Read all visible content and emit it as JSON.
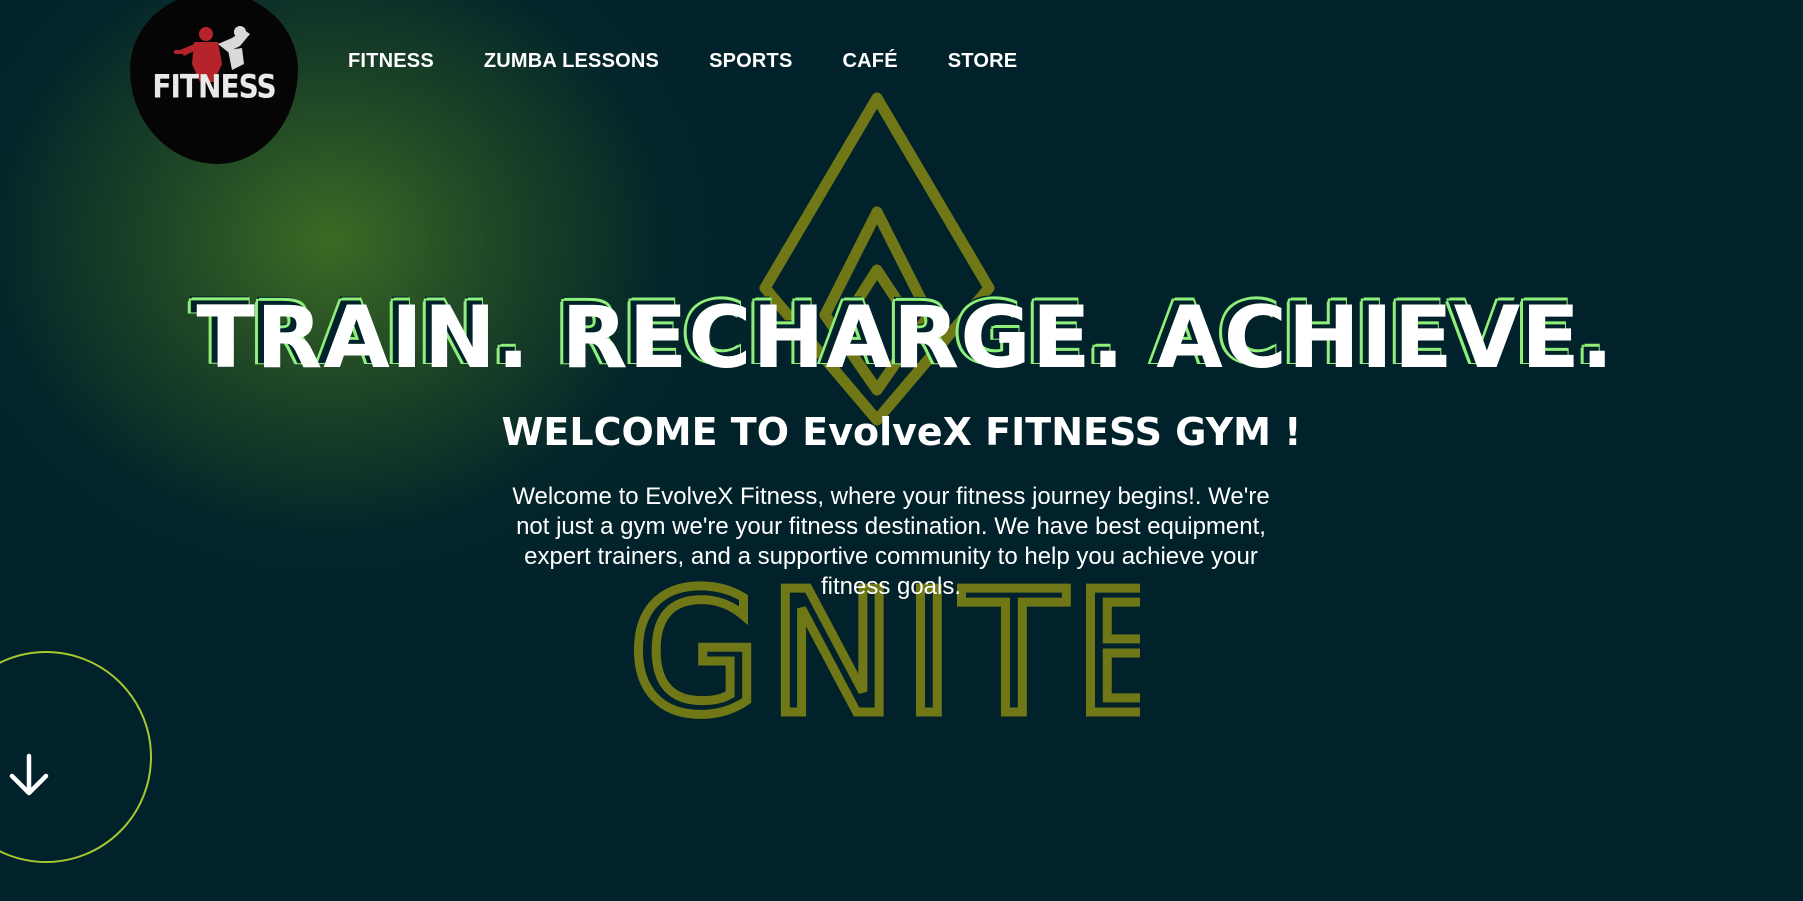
{
  "brand": {
    "logo_text": "FITNESS"
  },
  "nav": {
    "items": [
      {
        "label": "FITNESS"
      },
      {
        "label": "ZUMBA LESSONS"
      },
      {
        "label": "SPORTS"
      },
      {
        "label": "CAFÉ"
      },
      {
        "label": "STORE"
      }
    ]
  },
  "hero": {
    "headline": "TRAIN. RECHARGE. ACHIEVE.",
    "welcome": "WELCOME TO EvolveX FITNESS GYM !",
    "intro": "Welcome to EvolveX Fitness, where your fitness journey begins!. We're not just a gym we're your fitness destination. We have best equipment, expert trainers, and a supportive community to help you achieve your fitness goals.",
    "watermark_text": "IGNITE",
    "scroll_icon": "arrow-down-icon"
  },
  "colors": {
    "background": "#01222b",
    "glow": "#406e24",
    "accent_green": "#8ef07a",
    "circle_outline": "#a6c82e",
    "watermark": "#8f8f12"
  }
}
